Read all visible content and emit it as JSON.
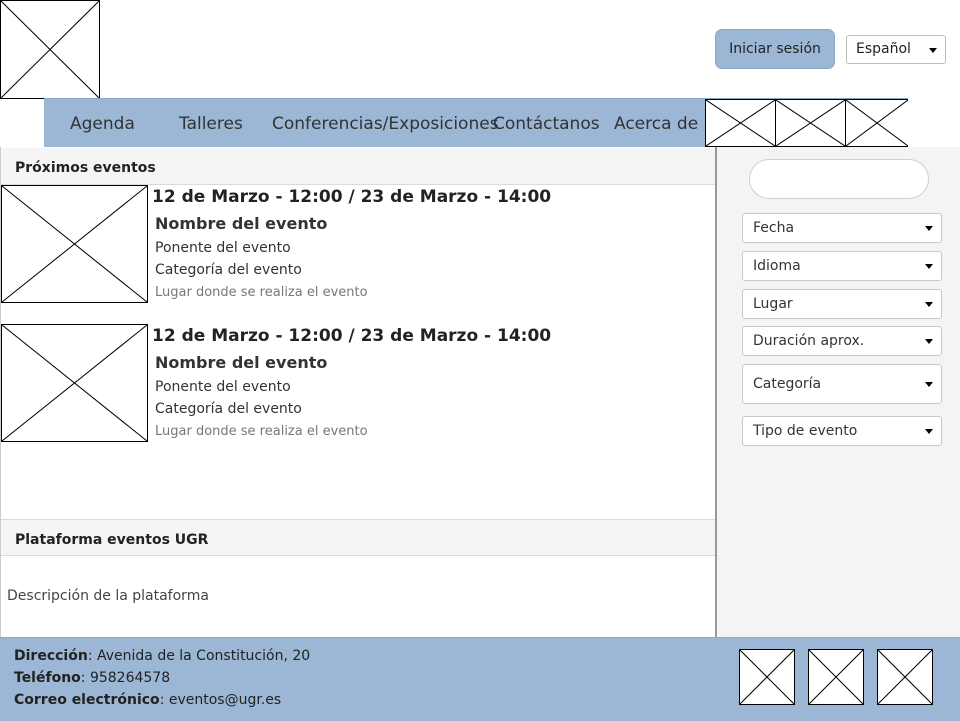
{
  "header": {
    "login_label": "Iniciar sesión",
    "language": "Español"
  },
  "nav": {
    "items": [
      "Agenda",
      "Talleres",
      "Conferencias/Exposiciones",
      "Contáctanos",
      "Acerca de"
    ]
  },
  "upcoming": {
    "title": "Próximos eventos",
    "events": [
      {
        "date": "12 de Marzo - 12:00 / 23 de Marzo - 14:00",
        "name": "Nombre del evento",
        "speaker": "Ponente del evento",
        "category": "Categoría del evento",
        "place": "Lugar donde se realiza el evento"
      },
      {
        "date": "12 de Marzo - 12:00 / 23 de Marzo - 14:00",
        "name": "Nombre del evento",
        "speaker": "Ponente del evento",
        "category": "Categoría del evento",
        "place": "Lugar donde se realiza el evento"
      }
    ]
  },
  "platform": {
    "title": "Plataforma eventos UGR",
    "description": "Descripción de la plataforma"
  },
  "filters": [
    "Fecha",
    "Idioma",
    "Lugar",
    "Duración aprox.",
    "Categoría",
    "Tipo de evento"
  ],
  "footer": {
    "address_label": "Dirección",
    "address": ": Avenida de la Constitución, 20",
    "phone_label": "Teléfono",
    "phone": ": 958264578",
    "email_label": "Correo electrónico",
    "email": ": eventos@ugr.es"
  }
}
